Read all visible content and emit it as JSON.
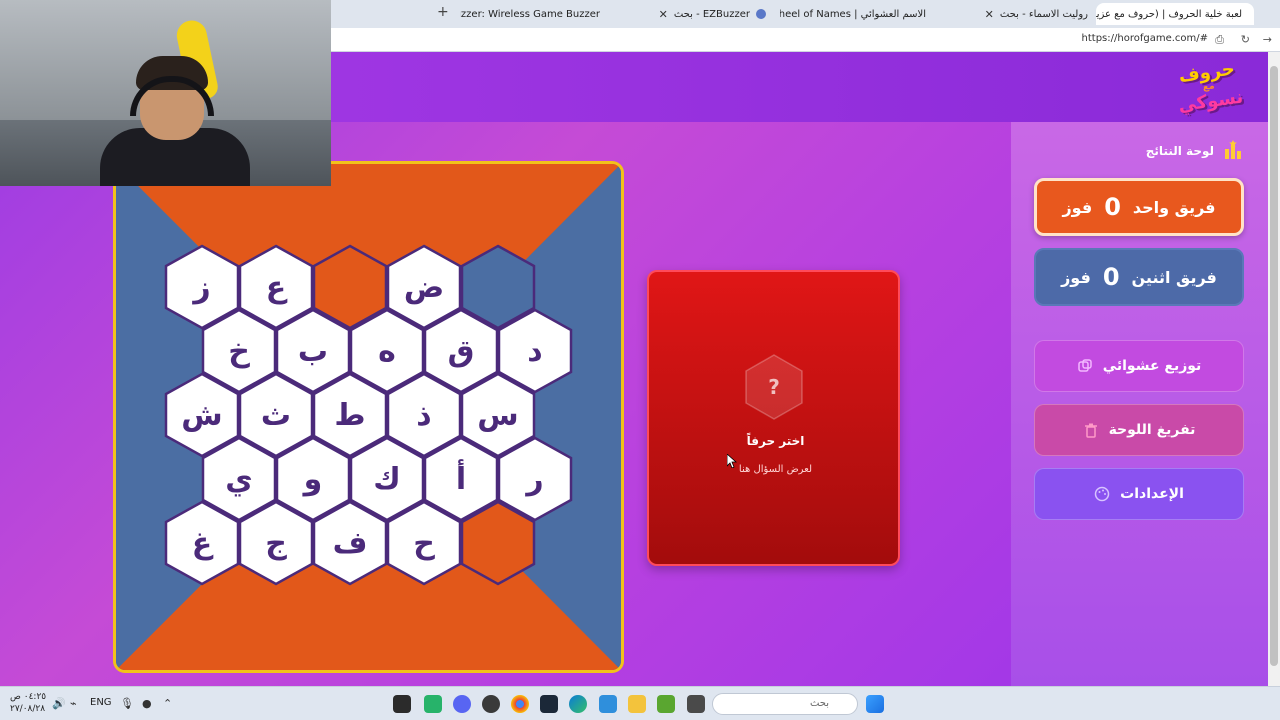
{
  "browser": {
    "tabs": [
      {
        "label": "لعبة خلية الحروف | (حروف مع عزيز) -",
        "active": true
      },
      {
        "label": "روليت الاسماء - بحث",
        "active": false
      },
      {
        "label": "الاسم العشوائي | Wheel of Names",
        "active": false
      },
      {
        "label": "EZBuzzer - بحث",
        "active": false
      },
      {
        "label": "EZBuzzer: Wireless Game Buzzer -",
        "active": false
      }
    ],
    "url": "https://horofgame.com/#"
  },
  "logo": {
    "line1": "حروف",
    "line2": "مع",
    "line3": "نسوكي"
  },
  "scoreboard": {
    "title": "لوحة النتائج",
    "teams": [
      {
        "name": "فريق واحد",
        "score": "0",
        "suffix": "فوز",
        "color": "#e8581e"
      },
      {
        "name": "فريق اثنين",
        "score": "0",
        "suffix": "فوز",
        "color": "#4d6aa8"
      }
    ]
  },
  "actions": {
    "random": "توزيع عشوائي",
    "clear": "تفريغ اللوحة",
    "settings": "الإعدادات"
  },
  "board": {
    "colors": {
      "orange": "#e2581a",
      "blue": "#4b6ea3",
      "white": "#ffffff",
      "border": "#f2c21a"
    },
    "rows": [
      [
        "ز",
        "ع",
        "",
        "ض",
        ""
      ],
      [
        "خ",
        "ب",
        "ه",
        "ق",
        "د"
      ],
      [
        "ش",
        "ث",
        "ط",
        "ذ",
        "س"
      ],
      [
        "ي",
        "و",
        "ك",
        "أ",
        "ر"
      ],
      [
        "غ",
        "ج",
        "ف",
        "ح",
        ""
      ]
    ],
    "cell_states": [
      [
        "white",
        "white",
        "orange",
        "white",
        "blue"
      ],
      [
        "white",
        "white",
        "white",
        "white",
        "white"
      ],
      [
        "white",
        "white",
        "white",
        "white",
        "white"
      ],
      [
        "white",
        "white",
        "white",
        "white",
        "white"
      ],
      [
        "white",
        "white",
        "white",
        "white",
        "orange"
      ]
    ]
  },
  "question": {
    "mark": "?",
    "title": "اختر حرفاً",
    "subtitle": "لعرض السؤال هنا"
  },
  "taskbar": {
    "time": "٠٤:٢٥ ص",
    "date": "٢٧/٠٨/٢٨",
    "lang": "ENG",
    "search_placeholder": "بحث"
  }
}
